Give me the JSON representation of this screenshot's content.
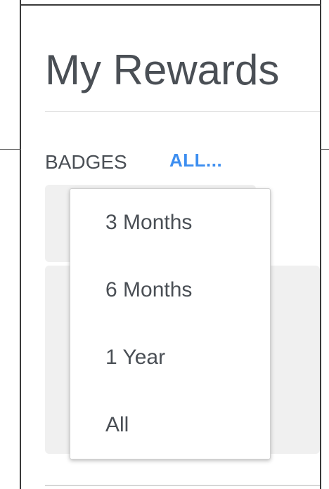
{
  "page": {
    "title": "My Rewards"
  },
  "tabs": {
    "badges_label": "BADGES",
    "filter_label": "ALL..."
  },
  "dropdown": {
    "options": [
      "3 Months",
      "6 Months",
      "1 Year",
      "All"
    ]
  },
  "colors": {
    "text": "#4a4f55",
    "accent": "#3d8ef0",
    "card_bg": "#f0f0f0"
  }
}
